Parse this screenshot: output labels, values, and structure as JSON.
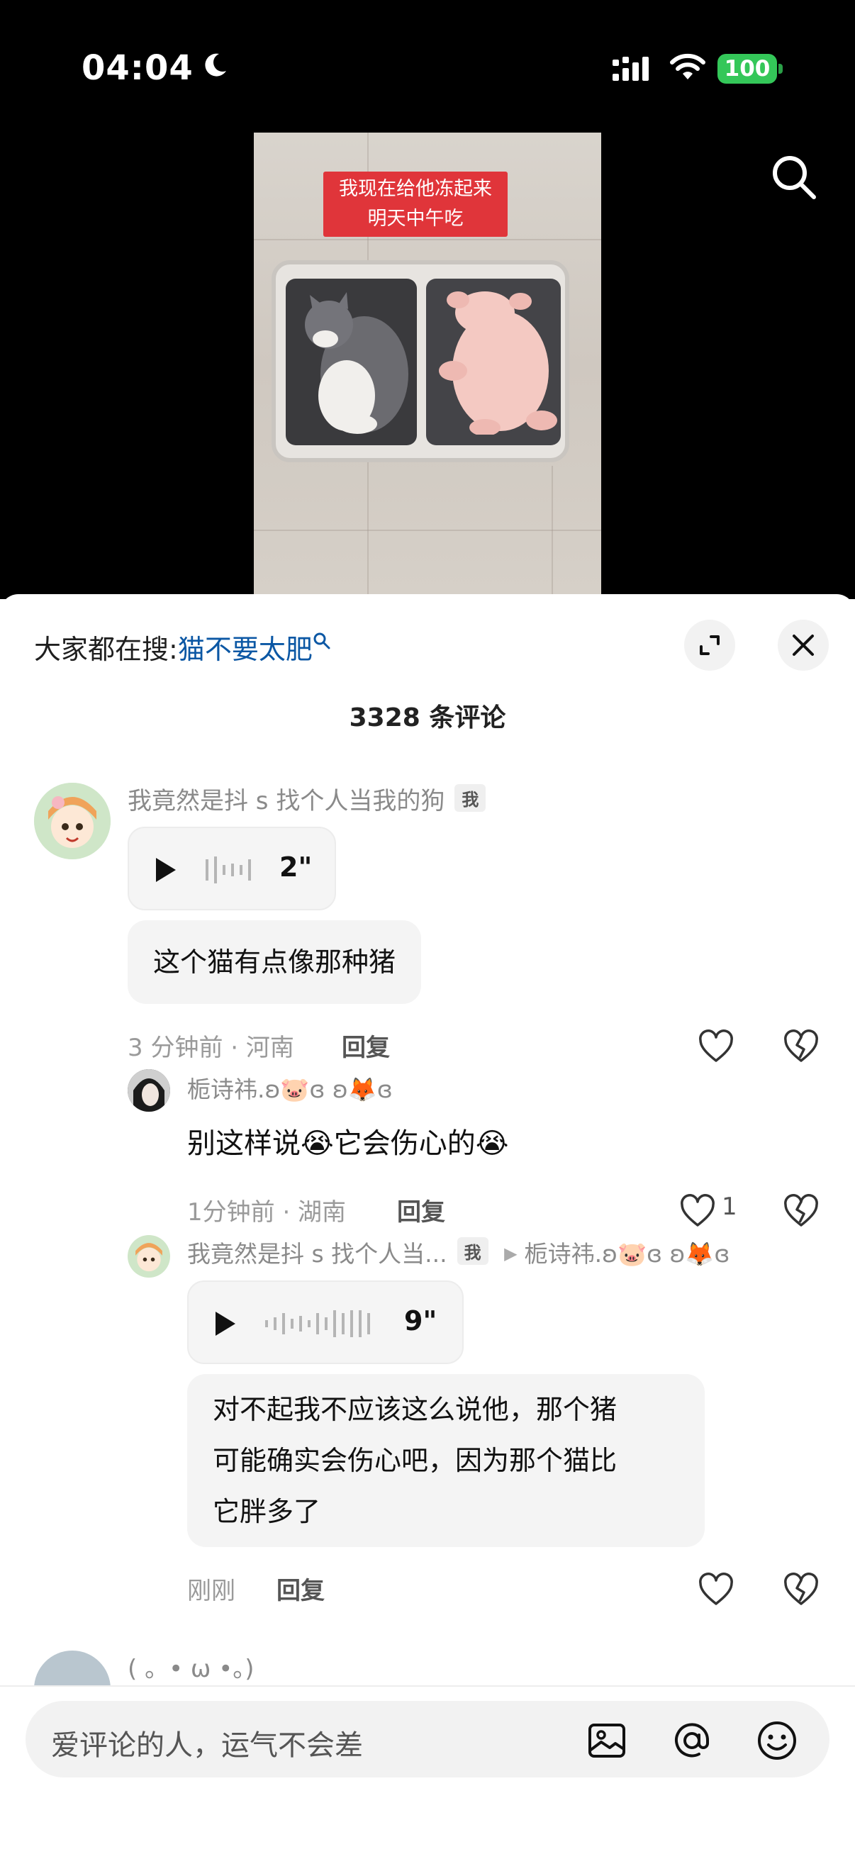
{
  "status_bar": {
    "time": "04:04",
    "battery": "100",
    "icons": [
      "moon-icon",
      "cellular-signal-icon",
      "wifi-icon",
      "battery-icon"
    ]
  },
  "video": {
    "caption_line1": "我现在给他冻起来",
    "caption_line2": "明天中午吃"
  },
  "sheet": {
    "trending_prefix": "大家都在搜:",
    "trending_query": "猫不要太肥",
    "comment_count": "3328 条评论"
  },
  "comments": [
    {
      "user": "我竟然是抖 s 找个人当我的狗",
      "badge": "我",
      "voice_duration": "2\"",
      "text": "这个猫有点像那种猪",
      "meta": "3 分钟前 · 河南",
      "reply_label": "回复"
    }
  ],
  "replies": [
    {
      "user": "栀诗祎.ʚ🐷ɞ ʚ🦊ɞ",
      "text": "别这样说😭它会伤心的😭",
      "meta": "1分钟前 · 湖南",
      "reply_label": "回复",
      "likes": "1"
    },
    {
      "user": "我竟然是抖 s 找个人当...",
      "badge": "我",
      "reply_to": "栀诗祎.ʚ🐷ɞ ʚ🦊ɞ",
      "voice_duration": "9\"",
      "text_line1": "对不起我不应该这么说他，那个猪",
      "text_line2": "可能确实会伤心吧，因为那个猫比",
      "text_line3": "它胖多了",
      "meta": "刚刚",
      "reply_label": "回复"
    }
  ],
  "next_comment_user": "( 。• ω •。)",
  "input": {
    "placeholder": "爱评论的人，运气不会差"
  },
  "colors": {
    "link": "#0b57a4",
    "battery": "#34c759",
    "caption_bg": "#e0353a"
  }
}
